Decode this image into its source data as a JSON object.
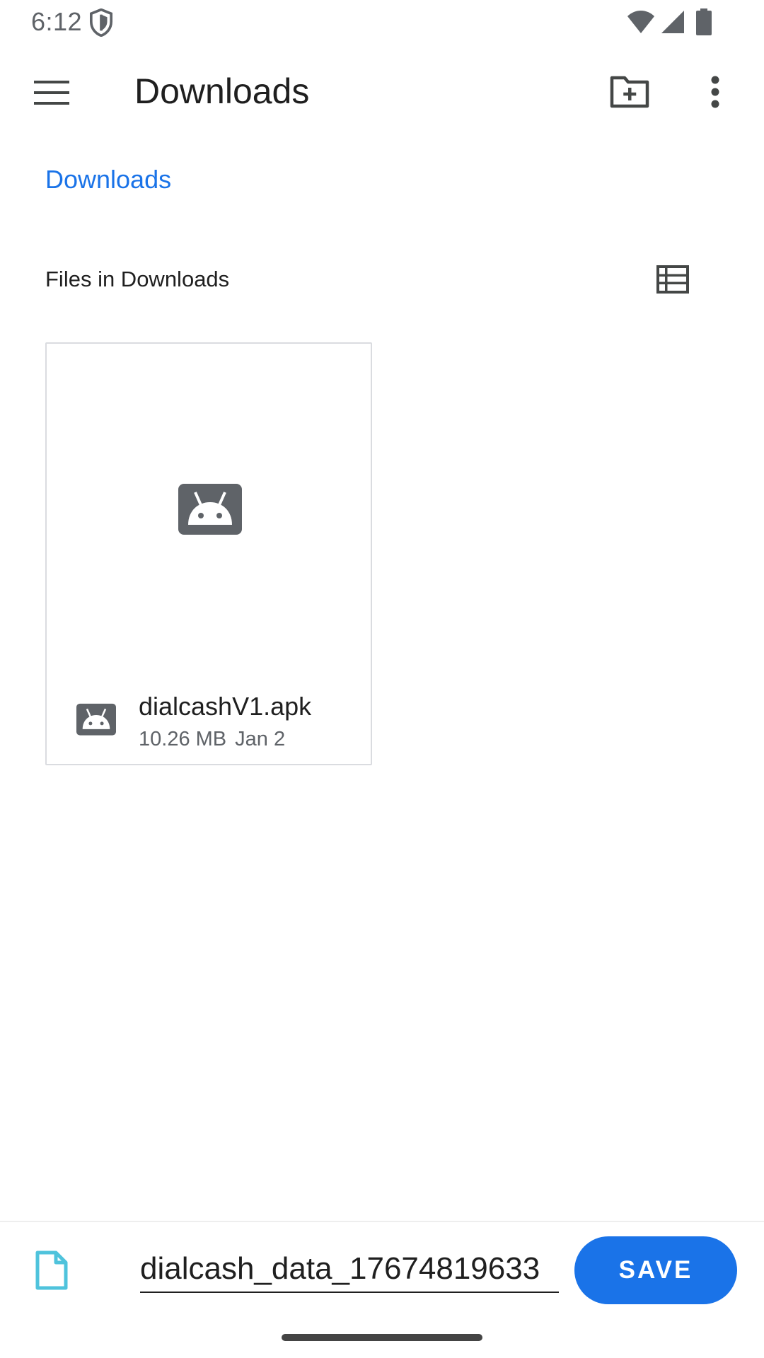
{
  "status_bar": {
    "time": "6:12",
    "icons": [
      "shield-icon",
      "wifi-icon",
      "signal-icon",
      "battery-icon"
    ]
  },
  "app_bar": {
    "title": "Downloads",
    "icons": [
      "menu-icon",
      "new-folder-icon",
      "more-vert-icon"
    ]
  },
  "breadcrumb": {
    "label": "Downloads"
  },
  "section": {
    "title": "Files in Downloads",
    "view_toggle_icon": "list-view-icon"
  },
  "files": [
    {
      "name": "dialcashV1.apk",
      "size": "10.26 MB",
      "date": "Jan 2",
      "icon": "android-apk-icon"
    }
  ],
  "save_bar": {
    "file_icon": "document-icon",
    "filename_value": "dialcash_data_17674819633",
    "save_label": "SAVE"
  },
  "colors": {
    "accent": "#1a73e8",
    "text_primary": "#1f1f1f",
    "text_secondary": "#5f6368",
    "icon_gray": "#5f6368",
    "file_icon_teal": "#4fc3dc"
  }
}
